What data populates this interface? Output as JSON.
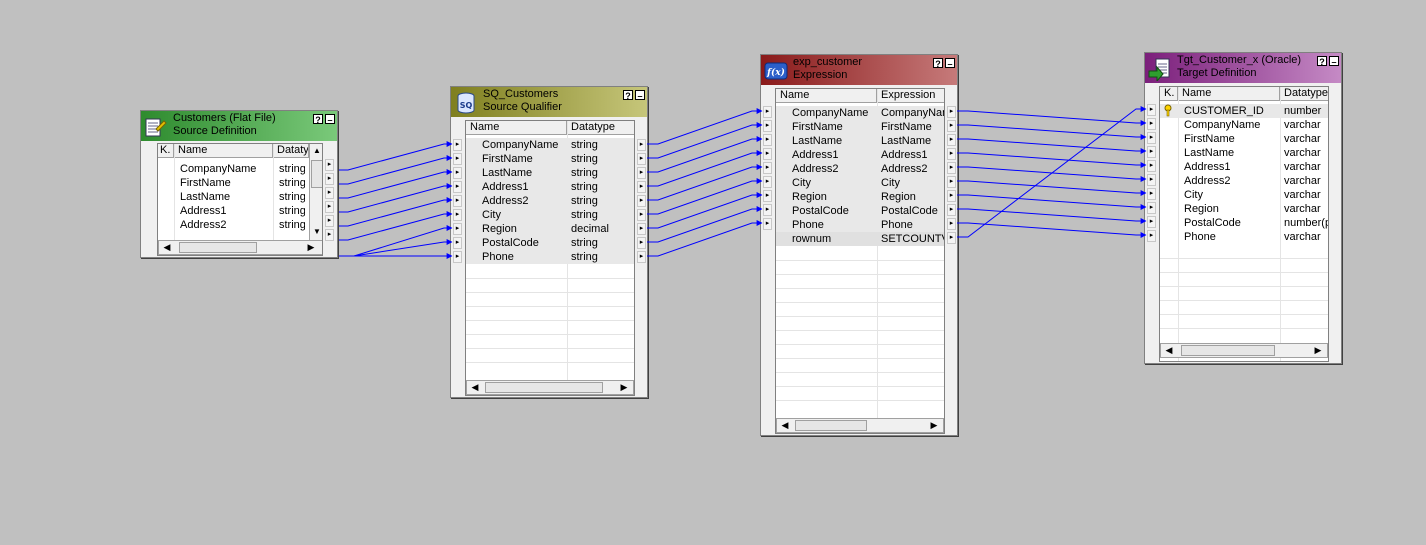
{
  "mapping": {
    "source": {
      "title": "Customers (Flat File)",
      "subtitle": "Source Definition",
      "columns": [
        "K.",
        "Name",
        "Datatype"
      ],
      "rows": [
        {
          "name": "CompanyName",
          "type": "string"
        },
        {
          "name": "FirstName",
          "type": "string"
        },
        {
          "name": "LastName",
          "type": "string"
        },
        {
          "name": "Address1",
          "type": "string"
        },
        {
          "name": "Address2",
          "type": "string"
        }
      ],
      "header_color": "#2e8b2e"
    },
    "qualifier": {
      "title": "SQ_Customers",
      "subtitle": "Source Qualifier",
      "columns": [
        "Name",
        "Datatype"
      ],
      "rows": [
        {
          "name": "CompanyName",
          "type": "string"
        },
        {
          "name": "FirstName",
          "type": "string"
        },
        {
          "name": "LastName",
          "type": "string"
        },
        {
          "name": "Address1",
          "type": "string"
        },
        {
          "name": "Address2",
          "type": "string"
        },
        {
          "name": "City",
          "type": "string"
        },
        {
          "name": "Region",
          "type": "decimal"
        },
        {
          "name": "PostalCode",
          "type": "string"
        },
        {
          "name": "Phone",
          "type": "string"
        }
      ],
      "header_color": "#7f7f1f"
    },
    "expression": {
      "title": "exp_customer",
      "subtitle": "Expression",
      "columns": [
        "Name",
        "Expression"
      ],
      "rows": [
        {
          "name": "CompanyName",
          "expr": "CompanyName"
        },
        {
          "name": "FirstName",
          "expr": "FirstName"
        },
        {
          "name": "LastName",
          "expr": "LastName"
        },
        {
          "name": "Address1",
          "expr": "Address1"
        },
        {
          "name": "Address2",
          "expr": "Address2"
        },
        {
          "name": "City",
          "expr": "City"
        },
        {
          "name": "Region",
          "expr": "Region"
        },
        {
          "name": "PostalCode",
          "expr": "PostalCode"
        },
        {
          "name": "Phone",
          "expr": "Phone"
        },
        {
          "name": "rownum",
          "expr": "SETCOUNTVA"
        }
      ],
      "header_color": "#8a1a1a"
    },
    "target": {
      "title": "Tgt_Customer_x (Oracle)",
      "subtitle": "Target Definition",
      "columns": [
        "K.",
        "Name",
        "Datatype"
      ],
      "rows": [
        {
          "name": "CUSTOMER_ID",
          "type": "number",
          "key": true
        },
        {
          "name": "CompanyName",
          "type": "varchar"
        },
        {
          "name": "FirstName",
          "type": "varchar"
        },
        {
          "name": "LastName",
          "type": "varchar"
        },
        {
          "name": "Address1",
          "type": "varchar"
        },
        {
          "name": "Address2",
          "type": "varchar"
        },
        {
          "name": "City",
          "type": "varchar"
        },
        {
          "name": "Region",
          "type": "varchar"
        },
        {
          "name": "PostalCode",
          "type": "number(p"
        },
        {
          "name": "Phone",
          "type": "varchar"
        }
      ],
      "header_color": "#7b1f7b"
    },
    "link_color": "#0000ff",
    "window_buttons": {
      "help": "?",
      "minimize": "–"
    }
  }
}
